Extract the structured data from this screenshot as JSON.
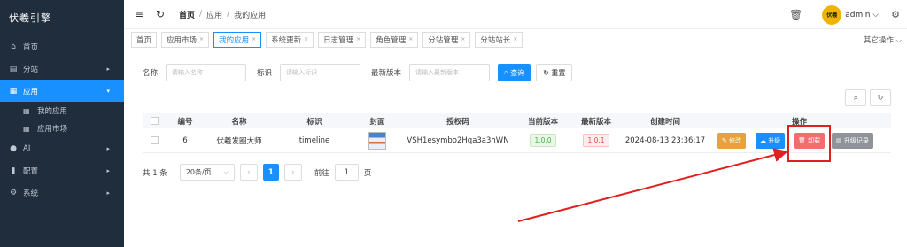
{
  "sidebar": {
    "logo": "伏羲引擎",
    "items": [
      {
        "icon": "home-icon",
        "glyph": "⌂",
        "label": "首页",
        "arrow": ""
      },
      {
        "icon": "site-icon",
        "glyph": "▤",
        "label": "分站",
        "arrow": "▸"
      },
      {
        "icon": "apps-icon",
        "glyph": "▦",
        "label": "应用",
        "arrow": "▾",
        "active": true
      }
    ],
    "subitems": [
      {
        "icon": "grid-icon",
        "glyph": "▦",
        "label": "我的应用"
      },
      {
        "icon": "grid-icon",
        "glyph": "▦",
        "label": "应用市场"
      }
    ],
    "items2": [
      {
        "icon": "ai-icon",
        "glyph": "●",
        "label": "AI",
        "arrow": "▸"
      },
      {
        "icon": "config-icon",
        "glyph": "▮",
        "label": "配置",
        "arrow": "▸"
      },
      {
        "icon": "system-icon",
        "glyph": "⚙",
        "label": "系统",
        "arrow": "▸"
      }
    ]
  },
  "header": {
    "breadcrumb": [
      "首页",
      "应用",
      "我的应用"
    ],
    "separator": "/",
    "username": "admin",
    "avatar_text": "伏羲"
  },
  "tabs": {
    "items": [
      "首页",
      "应用市场",
      "我的应用",
      "系统更新",
      "日志管理",
      "角色管理",
      "分站管理",
      "分站站长"
    ],
    "active": 2,
    "more": "其它操作"
  },
  "search": {
    "name_label": "名称",
    "name_placeholder": "请输入名称",
    "id_label": "标识",
    "id_placeholder": "请输入标识",
    "version_label": "最新版本",
    "version_placeholder": "请输入最新版本",
    "search_btn": "查询",
    "reset_btn": "重置"
  },
  "table": {
    "headers": [
      "编号",
      "名称",
      "标识",
      "封面",
      "授权码",
      "当前版本",
      "最新版本",
      "创建时间",
      "操作"
    ],
    "rows": [
      {
        "id": "6",
        "name": "伏羲发圈大师",
        "ident": "timeline",
        "code": "VSH1esymbo2Hqa3a3hWN",
        "cur": "1.0.0",
        "latest": "1.0.1",
        "time": "2024-08-13 23:36:17"
      }
    ],
    "actions": {
      "edit": "修改",
      "upgrade": "升级",
      "uninstall": "卸载",
      "log": "升级记录"
    }
  },
  "pager": {
    "total": "共 1 条",
    "size": "20条/页",
    "page": "1",
    "goto": "前往",
    "goto_value": "1",
    "unit": "页"
  }
}
